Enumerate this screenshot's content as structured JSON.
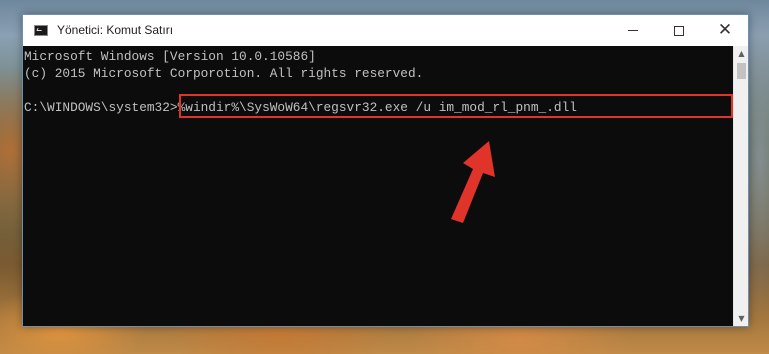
{
  "window": {
    "title": "Yönetici: Komut Satırı",
    "icon": "cmd-icon",
    "controls": {
      "minimize_icon": "minimize-icon",
      "maximize_icon": "maximize-icon",
      "close_icon": "close-icon",
      "close_glyph": "✕"
    }
  },
  "console": {
    "lines": [
      "Microsoft Windows [Version 10.0.10586]",
      "(c) 2015 Microsoft Corporotion. All rights reserved."
    ],
    "prompt": "C:\\WINDOWS\\system32>",
    "command": "%windir%\\SysWoW64\\regsvr32.exe /u im_mod_rl_pnm_.dll"
  },
  "annotation": {
    "highlight_color": "#e0342a",
    "arrow_color": "#e0342a",
    "arrow_icon": "red-arrow-icon"
  },
  "scrollbar": {
    "up_glyph": "▲",
    "down_glyph": "▼"
  }
}
